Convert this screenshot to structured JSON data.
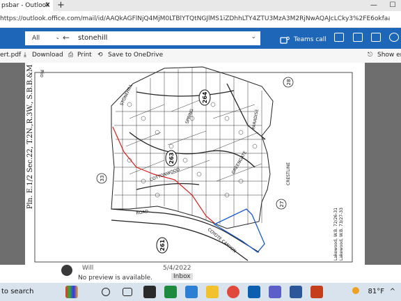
{
  "tabbar": {
    "tab_title": "psbar - Outlook",
    "close": "✕",
    "new_tab": "+",
    "min": "—",
    "max": "☐"
  },
  "address": {
    "url": "https://outlook.office.com/mail/id/AAQkAGFlNjQ4MjM0LTBlYTQtNGJlMS1iZDhhLTY4ZTU3MzA3M2RjNwAQAJcLCky3%2FE6okfaaW8..."
  },
  "outlook": {
    "scope": "All",
    "search_value": "stonehill",
    "teams_call": "Teams call"
  },
  "attachment_toolbar": {
    "filename": "ert.pdf",
    "download": "Download",
    "print": "Print",
    "save": "Save to OneDrive",
    "show": "Show em"
  },
  "map": {
    "left_title": "Pln. E.1/2 Sec.22, T.2N.,R.3W., S.B.B.&M",
    "corner_text_1": "Rio",
    "corner_text_2": "T.G",
    "corner_text_3": "105",
    "book_263": "263",
    "book_264": "264",
    "book_261": "261",
    "num_28": "28",
    "num_33": "33",
    "num_27": "27",
    "street_stonehill": "STONEHILL",
    "street_cottonwood": "COTTONWOOD",
    "street_crestline": "CRESTLINE",
    "street_paradise": "PARADISE",
    "street_coyote": "COYOTE CANYON",
    "street_spring": "SPRING",
    "street_greengate": "GREENGATE",
    "street_pine": "PINE",
    "street_road": "ROAD",
    "note_1": "Lakewood, W.B. 72/26-31",
    "note_2": "Lakewood, W.B. 73/27-33"
  },
  "mail": {
    "sender": "Will",
    "preview": "No preview is available.",
    "date": "5/4/2022",
    "folder": "Inbox"
  },
  "taskbar": {
    "search": "to search",
    "temp": "81°F"
  }
}
